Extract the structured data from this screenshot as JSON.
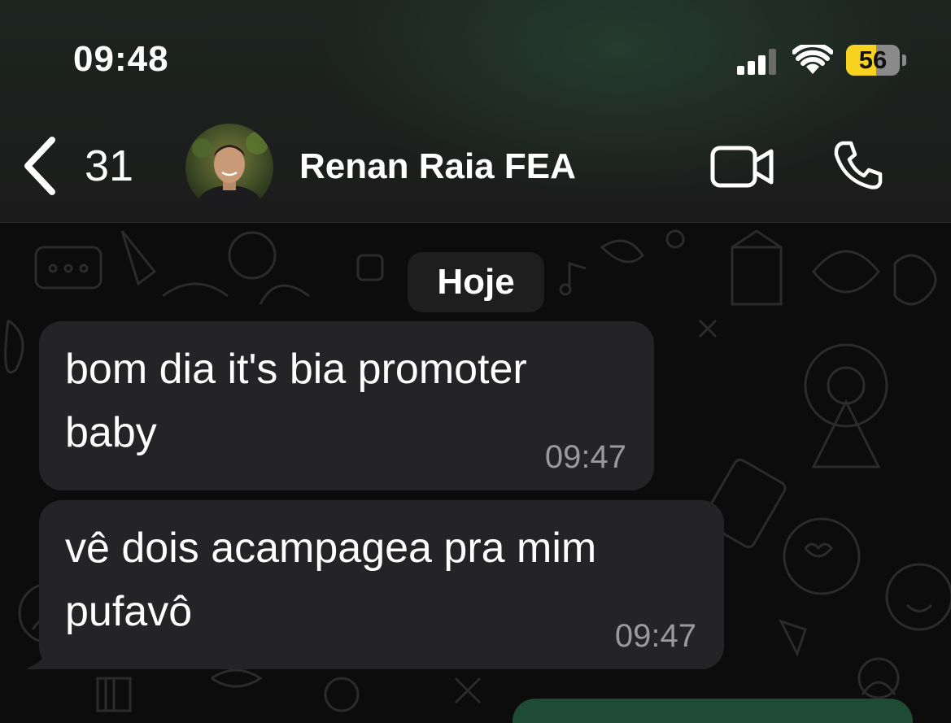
{
  "status_bar": {
    "time": "09:48",
    "battery_level": "56",
    "battery_fraction": 0.56,
    "signal_bars": 3,
    "icons": [
      "cellular-signal-icon",
      "wifi-icon",
      "battery-icon"
    ]
  },
  "header": {
    "back_count": "31",
    "contact_name": "Renan Raia FEA",
    "icons": [
      "back-chevron-icon",
      "avatar",
      "video-camera-icon",
      "phone-icon"
    ]
  },
  "chat": {
    "date_chip": "Hoje",
    "messages": [
      {
        "text": "bom dia it's bia promoter\nbaby",
        "time": "09:47",
        "direction": "incoming"
      },
      {
        "text": "vê dois acampagea pra mim\npufavô",
        "time": "09:47",
        "direction": "incoming"
      }
    ]
  },
  "colors": {
    "incoming_bubble": "#242426",
    "outgoing_bubble": "#1f4a33",
    "battery_yellow": "#f7d320",
    "timestamp_gray": "#9a9a9c",
    "chat_background": "#0c0c0c"
  }
}
